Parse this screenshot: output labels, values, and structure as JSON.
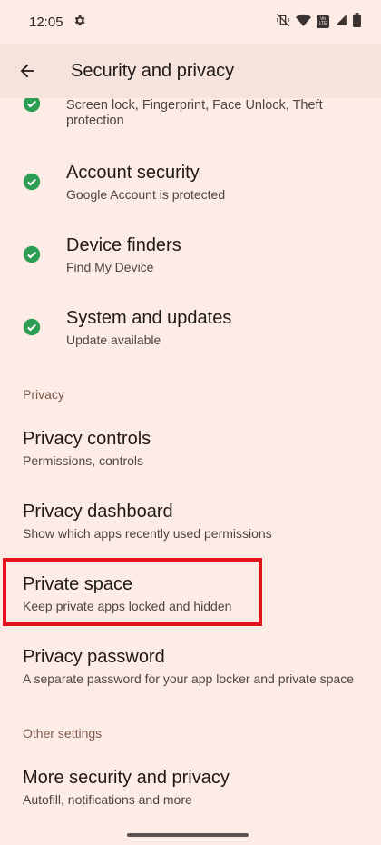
{
  "status_bar": {
    "time": "12:05",
    "icons": [
      "settings-gear-icon",
      "vibrate-off-icon",
      "wifi-icon",
      "volte-icon",
      "signal-icon",
      "battery-icon"
    ],
    "volte_label": "Vo LTE"
  },
  "top_bar": {
    "title": "Security and privacy",
    "back_icon": "arrow-back-icon"
  },
  "security_items": [
    {
      "title": "",
      "summary": "Screen lock, Fingerprint, Face Unlock, Theft protection",
      "status": "ok"
    },
    {
      "title": "Account security",
      "summary": "Google Account is protected",
      "status": "ok"
    },
    {
      "title": "Device finders",
      "summary": "Find My Device",
      "status": "ok"
    },
    {
      "title": "System and updates",
      "summary": "Update available",
      "status": "ok"
    }
  ],
  "privacy_section": {
    "header": "Privacy",
    "items": [
      {
        "title": "Privacy controls",
        "summary": "Permissions, controls"
      },
      {
        "title": "Privacy dashboard",
        "summary": "Show which apps recently used permissions"
      },
      {
        "title": "Private space",
        "summary": "Keep private apps locked and hidden"
      },
      {
        "title": "Privacy password",
        "summary": "A separate password for your app locker and private space"
      }
    ]
  },
  "other_section": {
    "header": "Other settings",
    "items": [
      {
        "title": "More security and privacy",
        "summary": "Autofill, notifications and more"
      }
    ]
  },
  "colors": {
    "background": "#fdece6",
    "check_green": "#2e9d54",
    "highlight_red": "#e4121c",
    "section_header": "#7b5a4a"
  }
}
